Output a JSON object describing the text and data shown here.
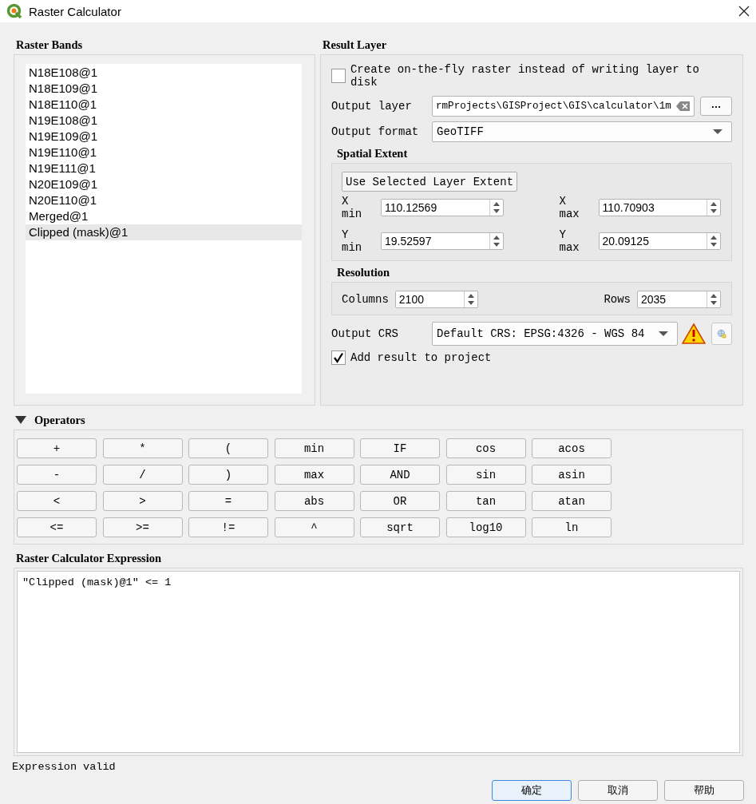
{
  "window": {
    "title": "Raster Calculator"
  },
  "raster_bands": {
    "title": "Raster Bands",
    "items": [
      {
        "label": "N18E108@1",
        "selected": false
      },
      {
        "label": "N18E109@1",
        "selected": false
      },
      {
        "label": "N18E110@1",
        "selected": false
      },
      {
        "label": "N19E108@1",
        "selected": false
      },
      {
        "label": "N19E109@1",
        "selected": false
      },
      {
        "label": "N19E110@1",
        "selected": false
      },
      {
        "label": "N19E111@1",
        "selected": false
      },
      {
        "label": "N20E109@1",
        "selected": false
      },
      {
        "label": "N20E110@1",
        "selected": false
      },
      {
        "label": "Merged@1",
        "selected": false
      },
      {
        "label": "Clipped (mask)@1",
        "selected": true
      }
    ]
  },
  "result_layer": {
    "title": "Result Layer",
    "on_the_fly": {
      "label": "Create on-the-fly raster instead of writing layer to disk",
      "checked": false
    },
    "output_layer": {
      "label": "Output layer",
      "value": "rmProjects\\GISProject\\GIS\\calculator\\1m",
      "browse": "…"
    },
    "output_format": {
      "label": "Output format",
      "value": "GeoTIFF"
    },
    "spatial_extent": {
      "title": "Spatial Extent",
      "button": "Use Selected Layer Extent",
      "fields": [
        {
          "label": "X min",
          "value": "110.12569"
        },
        {
          "label": "X max",
          "value": "110.70903"
        },
        {
          "label": "Y min",
          "value": "19.52597"
        },
        {
          "label": "Y max",
          "value": "20.09125"
        }
      ]
    },
    "resolution": {
      "title": "Resolution",
      "fields": [
        {
          "label": "Columns",
          "value": "2100"
        },
        {
          "label": "Rows",
          "value": "2035"
        }
      ]
    },
    "output_crs": {
      "label": "Output CRS",
      "value": "Default CRS: EPSG:4326 - WGS 84"
    },
    "add_to_project": {
      "label": "Add result to project",
      "checked": true
    }
  },
  "operators": {
    "title": "Operators",
    "expanded": true,
    "buttons": [
      "+",
      "*",
      "(",
      "min",
      "IF",
      "cos",
      "acos",
      "-",
      "/",
      ")",
      "max",
      "AND",
      "sin",
      "asin",
      "<",
      ">",
      "=",
      "abs",
      "OR",
      "tan",
      "atan",
      "<=",
      ">=",
      "!=",
      "^",
      "sqrt",
      "log10",
      "ln"
    ]
  },
  "expression": {
    "title": "Raster Calculator Expression",
    "value": "\"Clipped (mask)@1\" <= 1"
  },
  "status": "Expression valid",
  "buttons": [
    {
      "label": "确定",
      "focused": true
    },
    {
      "label": "取消",
      "focused": false
    },
    {
      "label": "帮助",
      "focused": false
    }
  ]
}
